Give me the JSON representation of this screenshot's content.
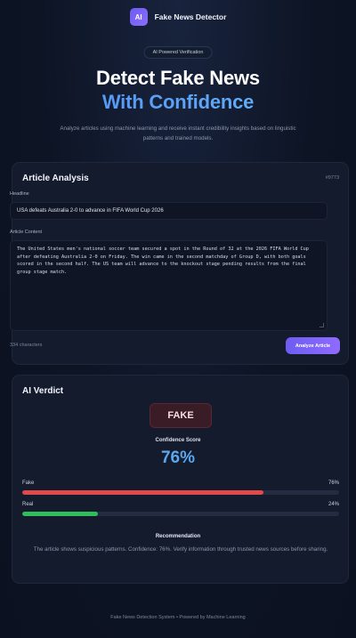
{
  "header": {
    "logo_text": "AI",
    "brand": "Fake News Detector"
  },
  "hero": {
    "badge": "AI Powered Verification",
    "title_line1": "Detect Fake News",
    "title_line2": "With Confidence",
    "subtitle": "Analyze articles using machine learning and receive instant credibility insights based on linguistic patterns and trained models."
  },
  "analysis": {
    "title": "Article Analysis",
    "id": "#9773",
    "headline_label": "Headline",
    "headline_value": "USA defeats Australia 2-0 to advance in FIFA World Cup 2026",
    "content_label": "Article Content",
    "content_value": "The United States men's national soccer team secured a spot in the Round of 32 at the 2026 FIFA World Cup after defeating Australia 2-0 on Friday. The win came in the second matchday of Group D, with both goals scored in the second half. The US team will advance to the knockout stage pending results from the final group stage match.",
    "char_count": "334 characters",
    "button_label": "Analyze Article"
  },
  "verdict": {
    "title": "AI Verdict",
    "result": "FAKE",
    "confidence_label": "Confidence Score",
    "confidence_value": "76%",
    "bars": [
      {
        "label": "Fake",
        "pct_text": "76%",
        "value": 0.76,
        "color": "#e04a4a"
      },
      {
        "label": "Real",
        "pct_text": "24%",
        "value": 0.24,
        "color": "#2fbf5a"
      }
    ],
    "recommendation_title": "Recommendation",
    "recommendation_text": "The article shows suspicious patterns. Confidence: 76%. Verify information through trusted news sources before sharing."
  },
  "footer": {
    "text": "Fake News Detection System • Powered by Machine Learning"
  },
  "colors": {
    "accent": "#7b64f6",
    "confidence": "#5aa7f0",
    "fake": "#e04a4a",
    "real": "#2fbf5a"
  }
}
